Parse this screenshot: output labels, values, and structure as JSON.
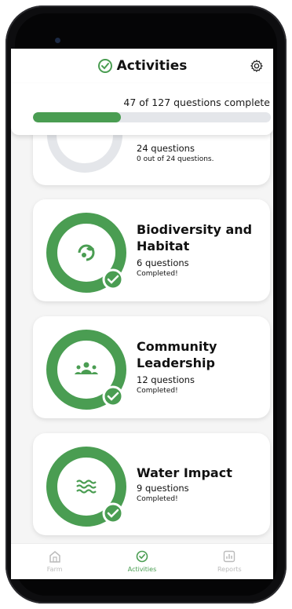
{
  "header": {
    "title": "Activities",
    "title_icon": "check-circle-icon",
    "settings_icon": "gear-icon"
  },
  "progress": {
    "text": "47 of 127 questions complete",
    "completed": 47,
    "total": 127
  },
  "cards": [
    {
      "title": "",
      "questions": "24 questions",
      "status": "0 out of 24 questions.",
      "icon": "partial-icon",
      "progress": 0
    },
    {
      "title_lines": [
        "Biodiversity and",
        "Habitat"
      ],
      "questions": "6 questions",
      "status": "Completed!",
      "icon": "leaf-cycle-icon",
      "progress": 1
    },
    {
      "title_lines": [
        "Community",
        "Leadership"
      ],
      "questions": "12 questions",
      "status": "Completed!",
      "icon": "people-group-icon",
      "progress": 1
    },
    {
      "title_lines": [
        "Water Impact"
      ],
      "questions": "9 questions",
      "status": "Completed!",
      "icon": "water-waves-icon",
      "progress": 1
    }
  ],
  "tabs": [
    {
      "label": "Farm",
      "icon": "barn-icon",
      "active": false
    },
    {
      "label": "Activities",
      "icon": "check-circle-icon",
      "active": true
    },
    {
      "label": "Reports",
      "icon": "bar-chart-icon",
      "active": false
    }
  ],
  "colors": {
    "accent": "#4a9d52",
    "track": "#e4e6ea"
  }
}
